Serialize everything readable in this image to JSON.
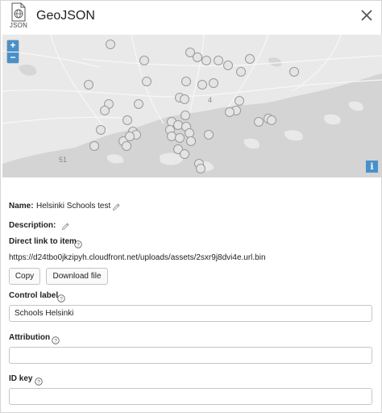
{
  "dialog": {
    "title": "GeoJSON",
    "file_type_label": "JSON"
  },
  "map": {
    "labels": [
      "4",
      "51"
    ],
    "zoom_in_label": "+",
    "zoom_out_label": "−",
    "info_label": "i",
    "accent_color": "#4a90c8"
  },
  "details": {
    "name_label": "Name:",
    "name_value": "Helsinki Schools test",
    "description_label": "Description:",
    "direct_link_label": "Direct link to item",
    "direct_link_value": "https://d24tbo0jkzipyh.cloudfront.net/uploads/assets/2sxr9j8dvi4e.url.bin",
    "copy_label": "Copy",
    "download_label": "Download file"
  },
  "fields": {
    "control_label": {
      "label": "Control label",
      "value": "Schools Helsinki"
    },
    "attribution": {
      "label": "Attribution",
      "value": ""
    },
    "id_key": {
      "label": "ID key",
      "value": ""
    }
  }
}
